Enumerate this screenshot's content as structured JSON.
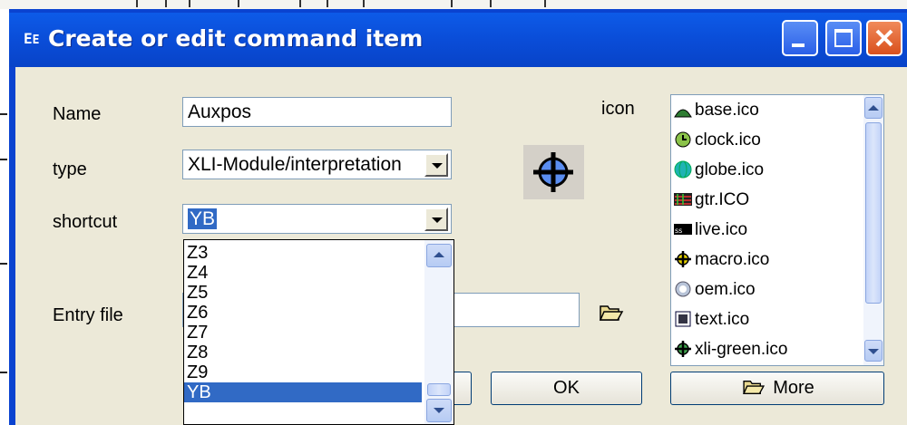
{
  "window": {
    "title": "Create or edit command item"
  },
  "form": {
    "name_label": "Name",
    "name_value": "Auxpos",
    "type_label": "type",
    "type_value": "XLI-Module/interpretation",
    "shortcut_label": "shortcut",
    "shortcut_value": "YB",
    "entry_file_label": "Entry file",
    "entry_file_value": "",
    "icon_label": "icon"
  },
  "shortcut_dropdown": {
    "options": [
      "Z3",
      "Z4",
      "Z5",
      "Z6",
      "Z7",
      "Z8",
      "Z9",
      "YB"
    ],
    "selected": "YB"
  },
  "icon_list": {
    "items": [
      {
        "label": "base.ico",
        "icon": "base-icon"
      },
      {
        "label": "clock.ico",
        "icon": "clock-icon"
      },
      {
        "label": "globe.ico",
        "icon": "globe-icon"
      },
      {
        "label": "gtr.ICO",
        "icon": "gtr-icon"
      },
      {
        "label": "live.ico",
        "icon": "live-icon"
      },
      {
        "label": "macro.ico",
        "icon": "macro-icon"
      },
      {
        "label": "oem.ico",
        "icon": "oem-icon"
      },
      {
        "label": "text.ico",
        "icon": "text-icon"
      },
      {
        "label": "xli-green.ico",
        "icon": "xli-green-icon"
      }
    ]
  },
  "buttons": {
    "ok": "OK",
    "more": "More"
  },
  "colors": {
    "titlebar": "#0a4dd8",
    "selection": "#316ac5",
    "client": "#ece9d8"
  }
}
